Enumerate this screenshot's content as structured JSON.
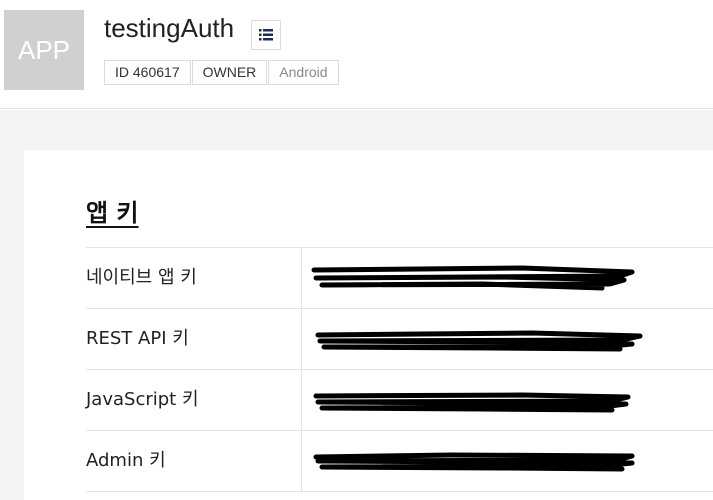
{
  "app": {
    "icon_text": "APP",
    "title": "testingAuth",
    "menu_icon": "list-icon",
    "badges": {
      "id": "ID 460617",
      "role": "OWNER",
      "platform": "Android"
    }
  },
  "section": {
    "title": "앱 키"
  },
  "keys": [
    {
      "label": "네이티브 앱 키",
      "value_state": "redacted"
    },
    {
      "label": "REST API 키",
      "value_state": "redacted"
    },
    {
      "label": "JavaScript 키",
      "value_state": "redacted"
    },
    {
      "label": "Admin 키",
      "value_state": "redacted"
    }
  ],
  "colors": {
    "icon_bg": "#d0d0d0",
    "menu_icon": "#1b2a6b",
    "page_bg": "#f4f4f4",
    "redaction": "#000000"
  }
}
